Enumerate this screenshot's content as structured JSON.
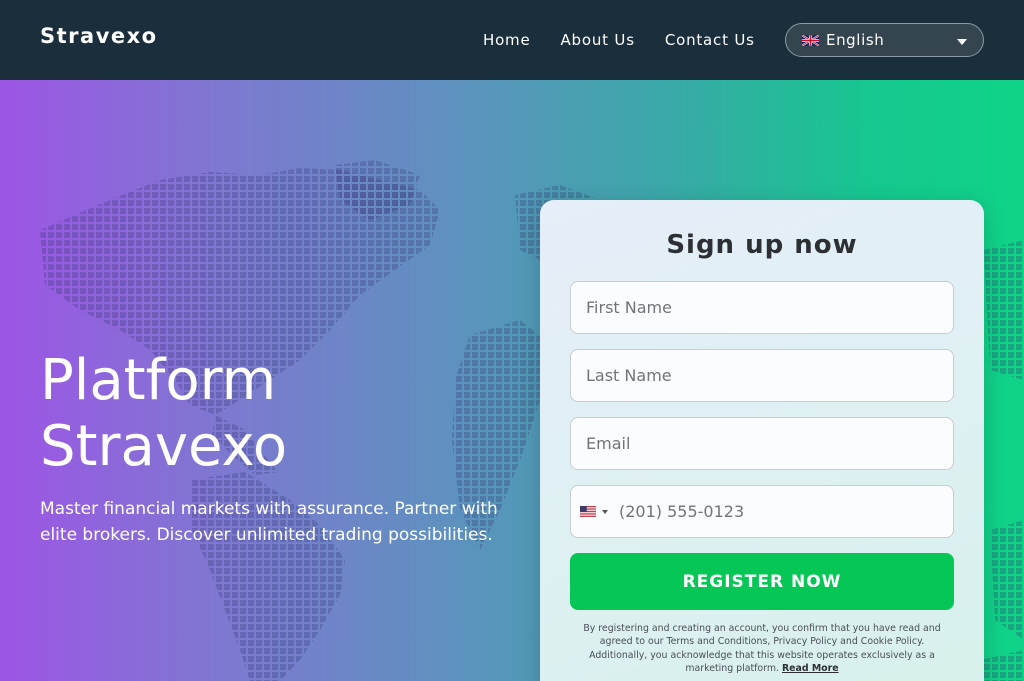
{
  "nav": {
    "brand": "Stravexo",
    "links": [
      "Home",
      "About Us",
      "Contact Us"
    ],
    "language": {
      "label": "English",
      "flag_icon": "uk-flag-icon"
    }
  },
  "hero": {
    "title_line1": "Platform",
    "title_line2": "Stravexo",
    "subtitle": "Master financial markets with assurance. Partner with elite brokers. Discover unlimited trading possibilities."
  },
  "signup": {
    "title": "Sign up now",
    "first_name_placeholder": "First Name",
    "last_name_placeholder": "Last Name",
    "email_placeholder": "Email",
    "phone_placeholder": "(201) 555-0123",
    "country_flag_icon": "us-flag-icon",
    "button_label": "REGISTER NOW",
    "disclaimer": "By registering and creating an account, you confirm that you have read and agreed to our Terms and Conditions, Privacy Policy and Cookie Policy. Additionally, you acknowledge that this website operates exclusively as a marketing platform.",
    "read_more": "Read More"
  },
  "colors": {
    "navbar": "#1b2e3c",
    "gradient_start": "#9d55e5",
    "gradient_end": "#0fd487",
    "button": "#06c755",
    "text_dark": "#2c2f33"
  }
}
